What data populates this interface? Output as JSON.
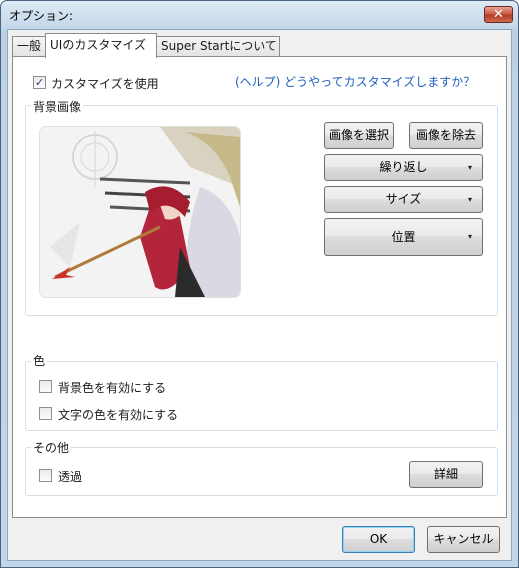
{
  "window": {
    "title": "オプション:",
    "close_glyph": "✕"
  },
  "tabs": [
    {
      "label": "一般",
      "active": false
    },
    {
      "label": "UIのカスタマイズ",
      "active": true
    },
    {
      "label": "Super Startについて",
      "active": false
    }
  ],
  "customize": {
    "use_label": "カスタマイズを使用",
    "use_checked": true,
    "help_link": "(ヘルプ) どうやってカスタマイズしますか？"
  },
  "background": {
    "group_title": "背景画像",
    "select_image": "画像を選択",
    "remove_image": "画像を除去",
    "repeat": "繰り返し",
    "size": "サイズ",
    "position": "位置",
    "dropdown_glyph": "▾"
  },
  "color": {
    "group_title": "色",
    "enable_bg_color": "背景色を有効にする",
    "enable_text_color": "文字の色を有効にする"
  },
  "other": {
    "group_title": "その他",
    "transparent": "透過",
    "details": "詳細"
  },
  "footer": {
    "ok": "OK",
    "cancel": "キャンセル"
  },
  "colors": {
    "accent_link": "#1f5fbf",
    "title_bar": "#c3d6e9",
    "close_button": "#c7523d"
  }
}
